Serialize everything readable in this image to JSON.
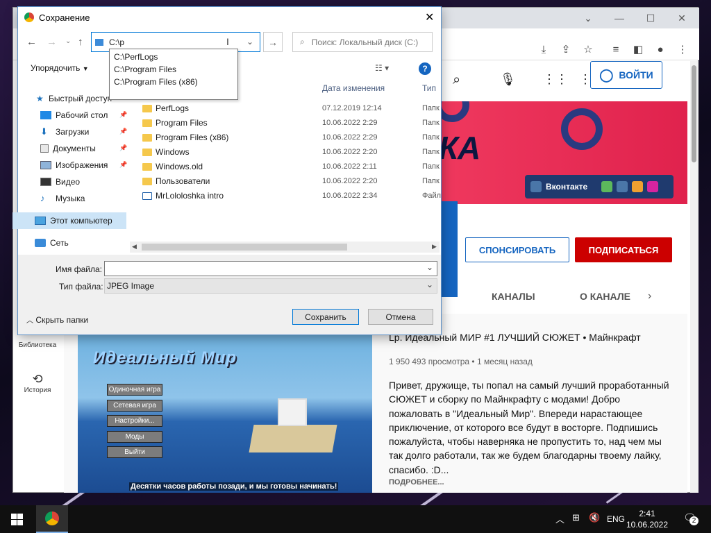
{
  "dialog": {
    "title": "Сохранение",
    "address_value": "C:\\p",
    "search_placeholder": "Поиск: Локальный диск (C:)",
    "autocomplete": [
      "C:\\PerfLogs",
      "C:\\Program Files",
      "C:\\Program Files (x86)"
    ],
    "organize_label": "Упорядочить",
    "columns": {
      "date": "Дата изменения",
      "type": "Тип"
    },
    "nav": {
      "quick_access": "Быстрый доступ",
      "desktop": "Рабочий стол",
      "downloads": "Загрузки",
      "documents": "Документы",
      "images": "Изображения",
      "video": "Видео",
      "music": "Музыка",
      "this_pc": "Этот компьютер",
      "network": "Сеть"
    },
    "files": [
      {
        "name": "PerfLogs",
        "date": "07.12.2019 12:14",
        "type": "Папк"
      },
      {
        "name": "Program Files",
        "date": "10.06.2022 2:29",
        "type": "Папк"
      },
      {
        "name": "Program Files (x86)",
        "date": "10.06.2022 2:29",
        "type": "Папк"
      },
      {
        "name": "Windows",
        "date": "10.06.2022 2:20",
        "type": "Папк"
      },
      {
        "name": "Windows.old",
        "date": "10.06.2022 2:11",
        "type": "Папк"
      },
      {
        "name": "Пользователи",
        "date": "10.06.2022 2:20",
        "type": "Папк"
      },
      {
        "name": "MrLololoshka intro",
        "date": "10.06.2022 2:34",
        "type": "Файл"
      }
    ],
    "filename_label": "Имя файла:",
    "filename_value": "",
    "filetype_label": "Тип файла:",
    "filetype_value": "JPEG Image",
    "hide_folders": "Скрыть папки",
    "save": "Сохранить",
    "cancel": "Отмена"
  },
  "youtube": {
    "login": "ВОЙТИ",
    "banner_text": "IКА",
    "social_label": "Вконтакте",
    "sponsor": "СПОНСИРОВАТЬ",
    "subscribe": "ПОДПИСАТЬСЯ",
    "tab_channels": "КАНАЛЫ",
    "tab_about": "О КАНАЛЕ",
    "sidebar_library": "Библиотека",
    "sidebar_history": "История",
    "video": {
      "thumb_title": "Идеальный Мир",
      "menu": [
        "Одиночная игра",
        "Сетевая игра",
        "Настройки...",
        "Моды",
        "Выйти"
      ],
      "caption": "Десятки часов работы позади, и мы готовы начинать!",
      "title": "Lp. Идеальный МИР #1 ЛУЧШИЙ СЮЖЕТ • Майнкрафт",
      "meta": "1 950 493 просмотра • 1 месяц назад",
      "description": "Привет, дружище, ты попал на самый лучший проработанный СЮЖЕТ и сборку по Майнкрафту с модами! Добро пожаловать в \"Идеальный Мир\". Впереди нарастающее приключение, от которого все будут в восторге. Подпишись пожалуйста, чтобы наверняка не пропустить то, над чем мы так долго работали, так же будем благодарны твоему лайку, спасибо. :D...",
      "more": "ПОДРОБНЕЕ..."
    }
  },
  "taskbar": {
    "lang": "ENG",
    "time": "2:41",
    "date": "10.06.2022",
    "notifications": "2"
  }
}
